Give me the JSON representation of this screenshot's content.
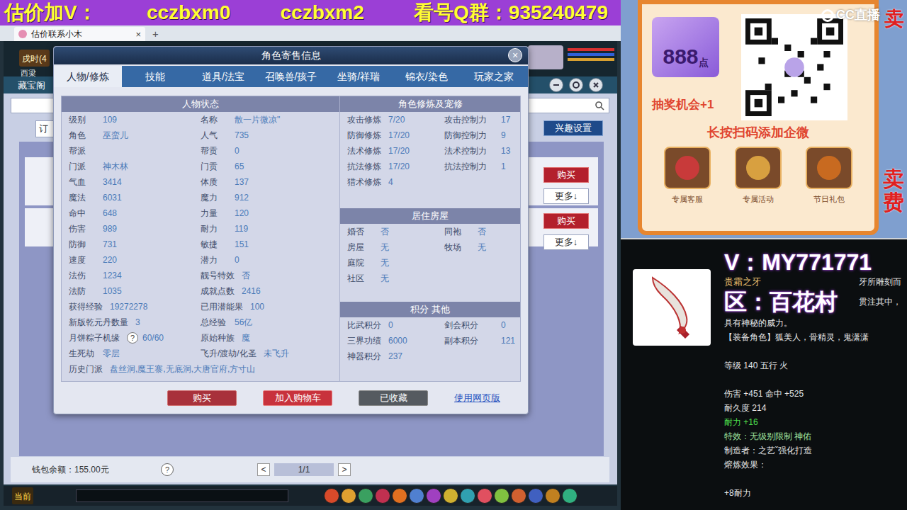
{
  "banner": {
    "parts": [
      "估价加V：",
      "cczbxm0",
      "cczbxm2",
      "看号Q群：935240479"
    ]
  },
  "browser": {
    "tabs": [
      {
        "label": "估价联系小木",
        "close": "×",
        "selected": true
      }
    ],
    "new_tab": "+"
  },
  "game": {
    "clock": "戌时(4",
    "location": "西梁",
    "panel_title": "藏宝阁",
    "filter": "订",
    "interest_button": "兴趣设置",
    "listings": [
      {
        "buy": "购买",
        "more": "更多↓"
      },
      {
        "buy": "购买",
        "more": "更多↓"
      }
    ],
    "wallet": "钱包余额：155.00元",
    "help": "?",
    "pager": {
      "prev": "<",
      "page": "1/1",
      "next": ">"
    },
    "chat_channel": "当前"
  },
  "modal": {
    "title": "角色寄售信息",
    "close": "×",
    "tabs": [
      {
        "label": "人物/修炼",
        "selected": true
      },
      {
        "label": "技能",
        "selected": false
      },
      {
        "label": "道具/法宝",
        "selected": false
      },
      {
        "label": "召唤兽/孩子",
        "selected": false
      },
      {
        "label": "坐骑/祥瑞",
        "selected": false
      },
      {
        "label": "锦衣/染色",
        "selected": false
      },
      {
        "label": "玩家之家",
        "selected": false
      }
    ],
    "status": {
      "title": "人物状态",
      "rows": [
        [
          {
            "label": "级别",
            "value": "109"
          },
          {
            "label": "名称",
            "value": "散一片微凉\""
          }
        ],
        [
          {
            "label": "角色",
            "value": "巫蛮儿"
          },
          {
            "label": "人气",
            "value": "735"
          }
        ],
        [
          {
            "label": "帮派"
          },
          {
            "label": "帮贡",
            "value": "0"
          }
        ],
        [
          {
            "label": "门派",
            "value": "神木林"
          },
          {
            "label": "门贡",
            "value": "65"
          }
        ],
        [
          {
            "label": "气血",
            "value": "3414"
          },
          {
            "label": "体质",
            "value": "137"
          }
        ],
        [
          {
            "label": "魔法",
            "value": "6031"
          },
          {
            "label": "魔力",
            "value": "912"
          }
        ],
        [
          {
            "label": "命中",
            "value": "648"
          },
          {
            "label": "力量",
            "value": "120"
          }
        ],
        [
          {
            "label": "伤害",
            "value": "989"
          },
          {
            "label": "耐力",
            "value": "119"
          }
        ],
        [
          {
            "label": "防御",
            "value": "731"
          },
          {
            "label": "敏捷",
            "value": "151"
          }
        ],
        [
          {
            "label": "速度",
            "value": "220"
          },
          {
            "label": "潜力",
            "value": "0"
          }
        ],
        [
          {
            "label": "法伤",
            "value": "1234"
          },
          {
            "label": "靓号特效",
            "value": "否"
          }
        ],
        [
          {
            "label": "法防",
            "value": "1035"
          },
          {
            "label": "成就点数",
            "value": "2416"
          }
        ],
        [
          {
            "label": "获得经验",
            "value": "19272278"
          },
          {
            "label": "已用潜能果",
            "value": "100"
          }
        ],
        [
          {
            "label": "新版乾元丹数量",
            "value": "3"
          },
          {
            "label": "总经验",
            "value": "56亿"
          }
        ],
        [
          {
            "label": "月饼粽子机缘",
            "help": "?",
            "value": "60/60"
          },
          {
            "label": "原始种族",
            "value": "魔"
          }
        ],
        [
          {
            "label": "生死劫",
            "value": "零层"
          },
          {
            "label": "飞升/渡劫/化圣",
            "value": "未飞升"
          }
        ],
        [
          {
            "label": "历史门派",
            "value": "盘丝洞,魔王寨,无底洞,大唐官府,方寸山"
          }
        ]
      ]
    },
    "cultivation": {
      "title": "角色修炼及宠修",
      "rows": [
        [
          {
            "label": "攻击修炼",
            "value": "7/20"
          },
          {
            "label": "攻击控制力",
            "value": "17"
          }
        ],
        [
          {
            "label": "防御修炼",
            "value": "17/20"
          },
          {
            "label": "防御控制力",
            "value": "9"
          }
        ],
        [
          {
            "label": "法术修炼",
            "value": "17/20"
          },
          {
            "label": "法术控制力",
            "value": "13"
          }
        ],
        [
          {
            "label": "抗法修炼",
            "value": "17/20"
          },
          {
            "label": "抗法控制力",
            "value": "1"
          }
        ],
        [
          {
            "label": "猎术修炼",
            "value": "4"
          }
        ]
      ]
    },
    "housing": {
      "title": "居住房屋",
      "rows": [
        [
          {
            "label": "婚否",
            "value": "否"
          },
          {
            "label": "同袍",
            "value": "否"
          }
        ],
        [
          {
            "label": "房屋",
            "value": "无"
          },
          {
            "label": "牧场",
            "value": "无"
          }
        ],
        [
          {
            "label": "庭院",
            "value": "无"
          }
        ],
        [
          {
            "label": "社区",
            "value": "无"
          }
        ]
      ]
    },
    "points": {
      "title": "积分 其他",
      "rows": [
        [
          {
            "label": "比武积分",
            "value": "0"
          },
          {
            "label": "剑会积分",
            "value": "0"
          }
        ],
        [
          {
            "label": "三界功绩",
            "value": "6000"
          },
          {
            "label": "副本积分",
            "value": "121"
          }
        ],
        [
          {
            "label": "神器积分",
            "value": "237"
          }
        ]
      ]
    },
    "actions": [
      {
        "label": "购买",
        "kind": "buy"
      },
      {
        "label": "加入购物车",
        "kind": "cart"
      },
      {
        "label": "已收藏",
        "kind": "saved"
      }
    ],
    "web_link": "使用网页版"
  },
  "stream": {
    "promo": {
      "badge_number": "888",
      "badge_unit": "点",
      "lottery": "抽奖机会+1",
      "scan_hint": "长按扫码添加企微",
      "perks": [
        "专属客服",
        "专属活动",
        "节日礼包"
      ]
    },
    "watermark": "CC直播",
    "side_top": "卖",
    "side_column": "卖费",
    "contact": "V：MY771771",
    "server": "区：百花村",
    "item": {
      "name": "贵霜之牙",
      "name_fragment": "牙所雕刻而",
      "server_fragment": "贯注其中，",
      "sections": [
        [
          {
            "text": "具有神秘的威力。",
            "color": "#e6e6e6"
          },
          {
            "text": "【装备角色】狐美人，骨精灵，鬼潇潇",
            "color": "#e6e6e6"
          }
        ],
        [
          {
            "text": "等级 140 五行 火",
            "color": "#e6e6e6"
          }
        ],
        [
          {
            "text": "伤害 +451 命中 +525",
            "color": "#e6e6e6"
          },
          {
            "text": "耐久度 214",
            "color": "#e6e6e6"
          },
          {
            "text": "耐力 +16",
            "color": "#4ee04e"
          },
          {
            "text": "特效：无级别限制 神佑",
            "color": "#9fe39f"
          },
          {
            "text": "制造者：之艺ˇ强化打造",
            "color": "#e6e6e6"
          },
          {
            "text": "熔炼效果：",
            "color": "#e6e6e6"
          }
        ],
        [
          {
            "text": "+8耐力",
            "color": "#e6e6e6"
          }
        ]
      ]
    }
  }
}
